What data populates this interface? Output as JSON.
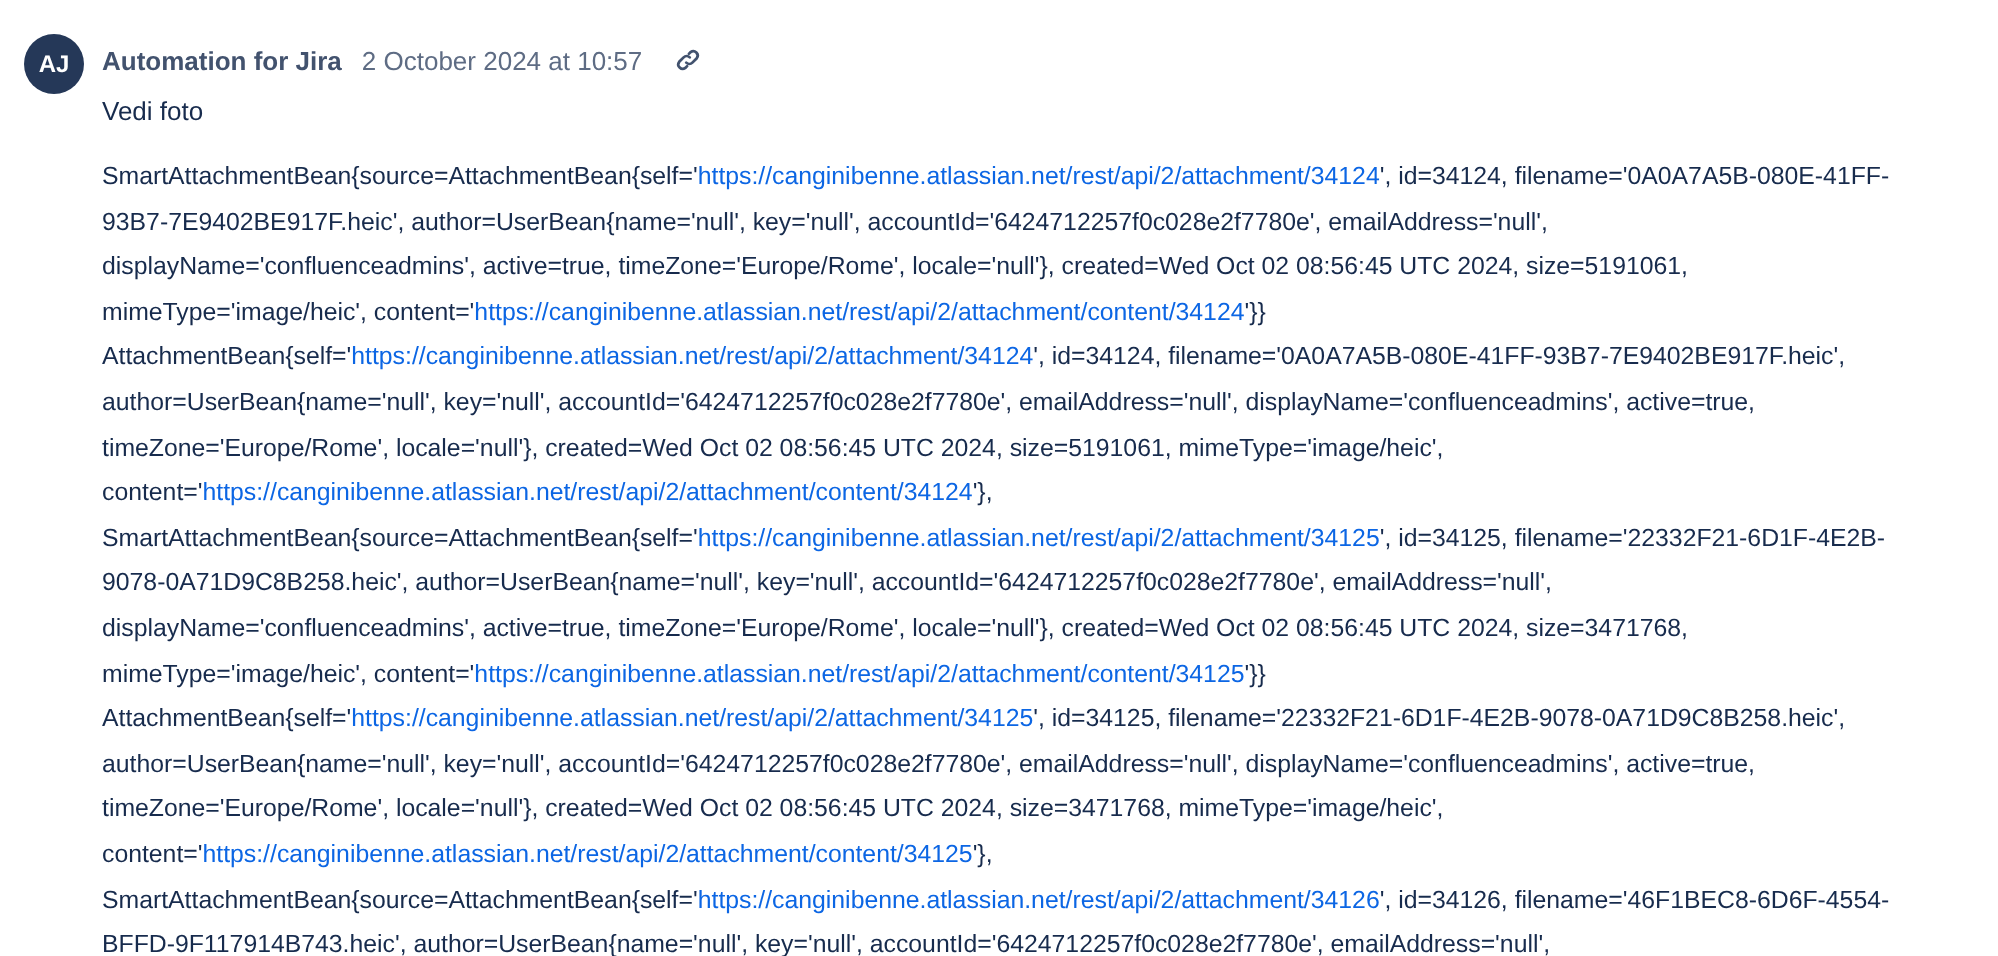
{
  "comment": {
    "avatar_initials": "AJ",
    "author": "Automation for Jira",
    "timestamp": "2 October 2024 at 10:57",
    "body_intro": "Vedi foto",
    "lines": [
      [
        {
          "kind": "text",
          "text": "SmartAttachmentBean{source=AttachmentBean{self='"
        },
        {
          "kind": "link",
          "text": "https://canginibenne.atlassian.net/rest/api/2/attachment/34124"
        },
        {
          "kind": "text",
          "text": "', id=34124, filename='0A0A7A5B-080E-41FF-"
        }
      ],
      [
        {
          "kind": "text",
          "text": "93B7-7E9402BE917F.heic', author=UserBean{name='null', key='null', accountId='6424712257f0c028e2f7780e', emailAddress='null',"
        }
      ],
      [
        {
          "kind": "text",
          "text": "displayName='confluenceadmins', active=true, timeZone='Europe/Rome', locale='null'}, created=Wed Oct 02 08:56:45 UTC 2024, size=5191061,"
        }
      ],
      [
        {
          "kind": "text",
          "text": "mimeType='image/heic', content='"
        },
        {
          "kind": "link",
          "text": "https://canginibenne.atlassian.net/rest/api/2/attachment/content/34124"
        },
        {
          "kind": "text",
          "text": "'}}"
        }
      ],
      [
        {
          "kind": "text",
          "text": "AttachmentBean{self='"
        },
        {
          "kind": "link",
          "text": "https://canginibenne.atlassian.net/rest/api/2/attachment/34124"
        },
        {
          "kind": "text",
          "text": "', id=34124, filename='0A0A7A5B-080E-41FF-93B7-7E9402BE917F.heic',"
        }
      ],
      [
        {
          "kind": "text",
          "text": "author=UserBean{name='null', key='null', accountId='6424712257f0c028e2f7780e', emailAddress='null', displayName='confluenceadmins', active=true,"
        }
      ],
      [
        {
          "kind": "text",
          "text": "timeZone='Europe/Rome', locale='null'}, created=Wed Oct 02 08:56:45 UTC 2024, size=5191061, mimeType='image/heic',"
        }
      ],
      [
        {
          "kind": "text",
          "text": "content='"
        },
        {
          "kind": "link",
          "text": "https://canginibenne.atlassian.net/rest/api/2/attachment/content/34124"
        },
        {
          "kind": "text",
          "text": "'},"
        }
      ],
      [
        {
          "kind": "text",
          "text": "SmartAttachmentBean{source=AttachmentBean{self='"
        },
        {
          "kind": "link",
          "text": "https://canginibenne.atlassian.net/rest/api/2/attachment/34125"
        },
        {
          "kind": "text",
          "text": "', id=34125, filename='22332F21-6D1F-4E2B-"
        }
      ],
      [
        {
          "kind": "text",
          "text": "9078-0A71D9C8B258.heic', author=UserBean{name='null', key='null', accountId='6424712257f0c028e2f7780e', emailAddress='null',"
        }
      ],
      [
        {
          "kind": "text",
          "text": "displayName='confluenceadmins', active=true, timeZone='Europe/Rome', locale='null'}, created=Wed Oct 02 08:56:45 UTC 2024, size=3471768,"
        }
      ],
      [
        {
          "kind": "text",
          "text": "mimeType='image/heic', content='"
        },
        {
          "kind": "link",
          "text": "https://canginibenne.atlassian.net/rest/api/2/attachment/content/34125"
        },
        {
          "kind": "text",
          "text": "'}}"
        }
      ],
      [
        {
          "kind": "text",
          "text": "AttachmentBean{self='"
        },
        {
          "kind": "link",
          "text": "https://canginibenne.atlassian.net/rest/api/2/attachment/34125"
        },
        {
          "kind": "text",
          "text": "', id=34125, filename='22332F21-6D1F-4E2B-9078-0A71D9C8B258.heic',"
        }
      ],
      [
        {
          "kind": "text",
          "text": "author=UserBean{name='null', key='null', accountId='6424712257f0c028e2f7780e', emailAddress='null', displayName='confluenceadmins', active=true,"
        }
      ],
      [
        {
          "kind": "text",
          "text": "timeZone='Europe/Rome', locale='null'}, created=Wed Oct 02 08:56:45 UTC 2024, size=3471768, mimeType='image/heic',"
        }
      ],
      [
        {
          "kind": "text",
          "text": "content='"
        },
        {
          "kind": "link",
          "text": "https://canginibenne.atlassian.net/rest/api/2/attachment/content/34125"
        },
        {
          "kind": "text",
          "text": "'},"
        }
      ],
      [
        {
          "kind": "text",
          "text": "SmartAttachmentBean{source=AttachmentBean{self='"
        },
        {
          "kind": "link",
          "text": "https://canginibenne.atlassian.net/rest/api/2/attachment/34126"
        },
        {
          "kind": "text",
          "text": "', id=34126, filename='46F1BEC8-6D6F-4554-"
        }
      ],
      [
        {
          "kind": "text",
          "text": "BFFD-9F117914B743.heic', author=UserBean{name='null', key='null', accountId='6424712257f0c028e2f7780e', emailAddress='null',"
        }
      ]
    ]
  }
}
